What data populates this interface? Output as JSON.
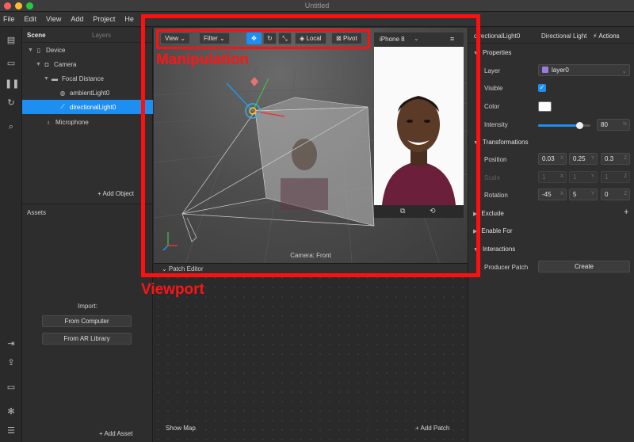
{
  "window": {
    "title": "Untitled"
  },
  "menu": [
    "File",
    "Edit",
    "View",
    "Add",
    "Project",
    "He"
  ],
  "scene_panel": {
    "tabs": [
      "Scene",
      "Layers"
    ],
    "tree": [
      {
        "label": "Device",
        "icon": "phone-icon",
        "expanded": true
      },
      {
        "label": "Camera",
        "icon": "camera-icon",
        "expanded": true
      },
      {
        "label": "Focal Distance",
        "icon": "focal-icon",
        "expanded": true
      },
      {
        "label": "ambientLight0",
        "icon": "globe-light-icon"
      },
      {
        "label": "directionalLight0",
        "icon": "directional-light-icon",
        "selected": true
      },
      {
        "label": "Microphone",
        "icon": "microphone-icon"
      }
    ],
    "add_object": "+ Add Object"
  },
  "assets_panel": {
    "title": "Assets",
    "import_label": "Import:",
    "from_computer": "From Computer",
    "from_ar_library": "From AR Library",
    "add_asset": "+ Add Asset"
  },
  "viewport": {
    "toolbar": {
      "view": "View ⌄",
      "filter": "Filter ⌄",
      "local": "Local",
      "pivot": "Pivot"
    },
    "camera_label": "Camera: Front"
  },
  "phone_preview": {
    "device": "iPhone 8",
    "device_caret": "⌄",
    "menu_glyph": "≡"
  },
  "patch_editor": {
    "header": "⌄  Patch Editor",
    "show_map": "Show Map",
    "add_patch": "+ Add Patch"
  },
  "properties": {
    "object_name": "directionalLight0",
    "object_type": "Directional Light",
    "actions": "Actions",
    "sections": {
      "properties": "Properties",
      "transformations": "Transformations",
      "exclude": "Exclude",
      "enable_for": "Enable For",
      "interactions": "Interactions"
    },
    "labels": {
      "layer": "Layer",
      "visible": "Visible",
      "color": "Color",
      "intensity": "Intensity",
      "position": "Position",
      "scale": "Scale",
      "rotation": "Rotation",
      "producer_patch": "Producer Patch"
    },
    "layer_value": "layer0",
    "visible": true,
    "color_hex": "#ffffff",
    "intensity_value": "80",
    "intensity_unit": "%",
    "intensity_fraction": 0.8,
    "position": [
      "0.03",
      "0.25",
      "0.3"
    ],
    "scale": [
      "1",
      "1",
      "1"
    ],
    "rotation": [
      "-45",
      "5",
      "0"
    ],
    "axes": [
      "X",
      "Y",
      "Z"
    ],
    "create_button": "Create"
  },
  "annotations": {
    "manipulation": "Manipulation",
    "viewport": "Viewport"
  },
  "colors": {
    "accent_blue": "#1f8ef1",
    "annotation_red": "#ff1010",
    "panel_bg": "#2f2f2f"
  }
}
